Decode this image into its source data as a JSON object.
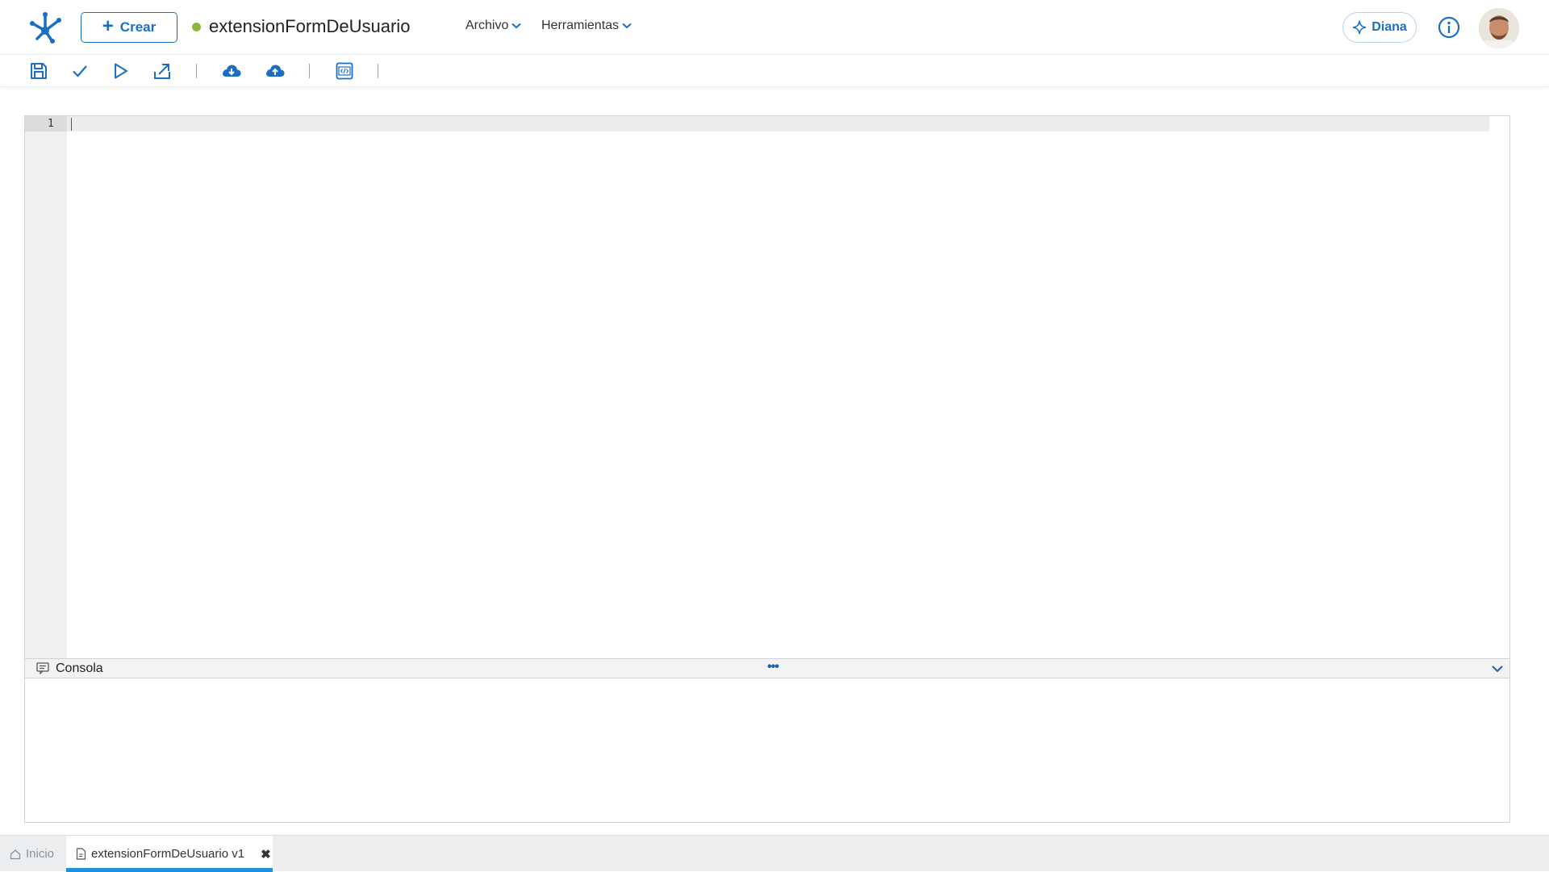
{
  "header": {
    "create_label": "Crear",
    "doc_title": "extensionFormDeUsuario",
    "status_color": "#8bb83a",
    "menus": [
      {
        "label": "Archivo"
      },
      {
        "label": "Herramientas"
      }
    ],
    "assistant_label": "Diana",
    "accent": "#1a6fc2"
  },
  "toolbar": {
    "icons": [
      "save-icon",
      "check-icon",
      "run-icon",
      "export-icon",
      "cloud-download-icon",
      "cloud-upload-icon",
      "code-view-icon"
    ]
  },
  "editor": {
    "lines": [
      "1"
    ]
  },
  "console": {
    "label": "Consola",
    "grip": "•••"
  },
  "tabs": [
    {
      "label": "Inicio",
      "icon": "home-icon"
    },
    {
      "label": "extensionFormDeUsuario v1",
      "icon": "document-icon",
      "close": "✖"
    }
  ]
}
